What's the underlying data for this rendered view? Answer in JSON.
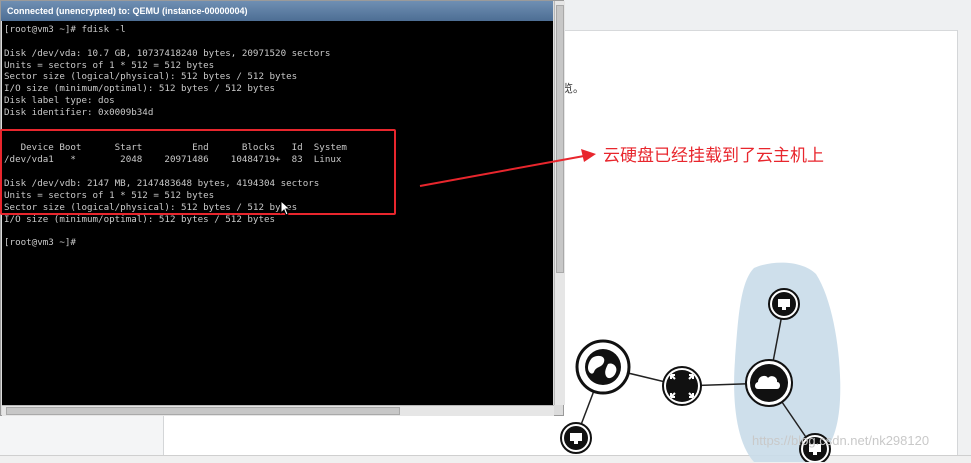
{
  "console": {
    "title": "Connected (unencrypted) to: QEMU (instance-00000004)",
    "lines": [
      "[root@vm3 ~]# fdisk -l",
      "",
      "Disk /dev/vda: 10.7 GB, 10737418240 bytes, 20971520 sectors",
      "Units = sectors of 1 * 512 = 512 bytes",
      "Sector size (logical/physical): 512 bytes / 512 bytes",
      "I/O size (minimum/optimal): 512 bytes / 512 bytes",
      "Disk label type: dos",
      "Disk identifier: 0x0009b34d",
      "",
      "",
      "   Device Boot      Start         End      Blocks   Id  System",
      "/dev/vda1   *        2048    20971486    10484719+  83  Linux",
      "",
      "Disk /dev/vdb: 2147 MB, 2147483648 bytes, 4194304 sectors",
      "Units = sectors of 1 * 512 = 512 bytes",
      "Sector size (logical/physical): 512 bytes / 512 bytes",
      "I/O size (minimum/optimal): 512 bytes / 512 bytes",
      "",
      "[root@vm3 ~]#"
    ]
  },
  "background": {
    "fragment_text": "览。"
  },
  "annotation": {
    "text": "云硬盘已经挂载到了云主机上",
    "color": "#e8262d"
  },
  "watermark": "https://blog.csdn.net/nk298120",
  "icons": {
    "globe": "globe-icon",
    "router": "router-icon",
    "cloud": "cloud-icon",
    "monitor": "monitor-icon"
  }
}
